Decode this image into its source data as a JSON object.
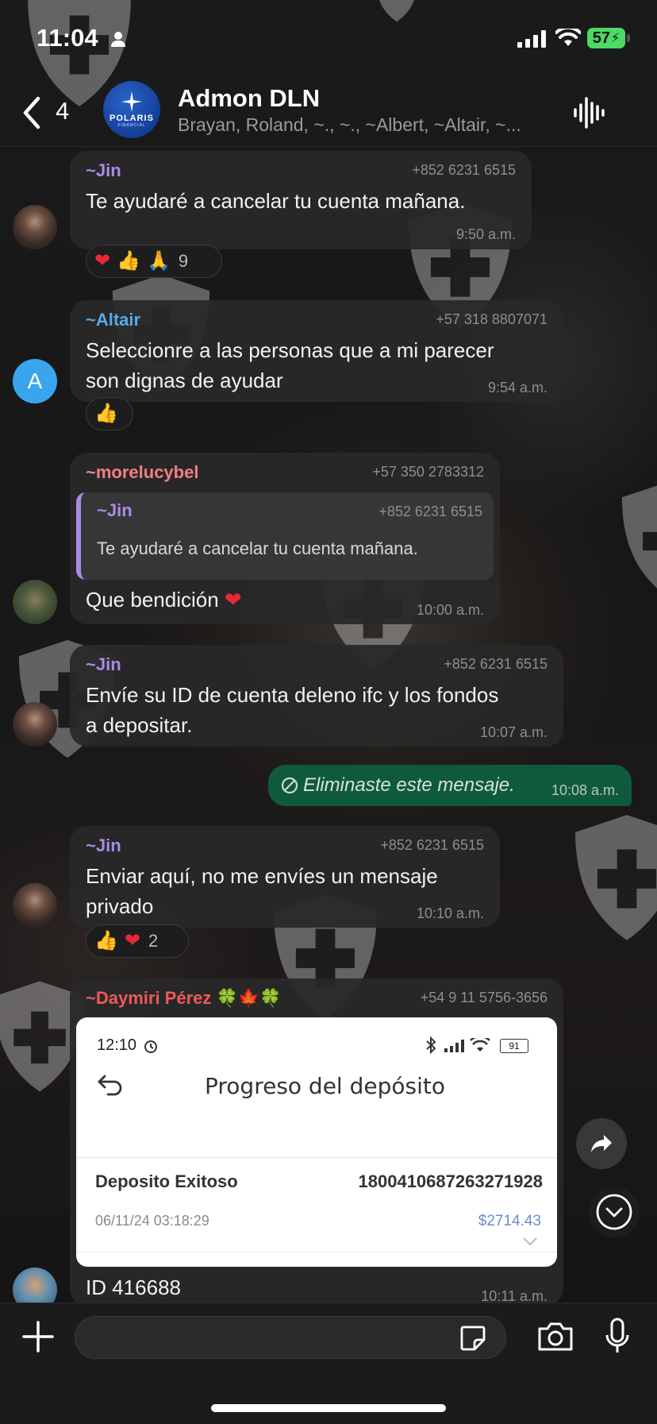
{
  "status_bar": {
    "time": "11:04",
    "battery": "57"
  },
  "header": {
    "back_count": "4",
    "avatar_brand": "POLARIS",
    "avatar_sub": "FINANCIAL",
    "title": "Admon DLN",
    "members": "Brayan, Roland, ~., ~., ~Albert, ~Altair, ~..."
  },
  "colors": {
    "jin": "#a98be6",
    "altair": "#5aa9e6",
    "morelucybel": "#f07f84",
    "daymiri": "#f0585a",
    "outgoing": "#0f5a3d"
  },
  "messages": [
    {
      "sender": "~Jin",
      "phone": "+852 6231 6515",
      "text": "Te ayudaré a cancelar tu cuenta mañana.",
      "time": "9:50 a.m.",
      "reactions": {
        "count": "9"
      }
    },
    {
      "sender": "~Altair",
      "phone": "+57 318 8807071",
      "text": "Seleccionre a las personas que a mi parecer son dignas de ayudar",
      "time": "9:54 a.m.",
      "avatar_letter": "A"
    },
    {
      "sender": "~morelucybel",
      "phone": "+57 350 2783312",
      "quote_sender": "~Jin",
      "quote_phone": "+852 6231 6515",
      "quote_text": "Te ayudaré a cancelar tu cuenta mañana.",
      "text": "Que bendición",
      "time": "10:00 a.m."
    },
    {
      "sender": "~Jin",
      "phone": "+852 6231 6515",
      "text": "Envíe su ID de cuenta deleno ifc y los fondos a depositar.",
      "time": "10:07 a.m."
    },
    {
      "outgoing_text": "Eliminaste este mensaje.",
      "time": "10:08 a.m."
    },
    {
      "sender": "~Jin",
      "phone": "+852 6231 6515",
      "text": "Enviar aquí, no me envíes un mensaje privado",
      "time": "10:10 a.m.",
      "reactions": {
        "count": "2"
      }
    },
    {
      "sender": "~Daymiri Pérez 🍀🍁🍀",
      "phone": "+54 9 11 5756-3656",
      "image": {
        "time": "12:10",
        "battery": "91",
        "title": "Progreso del depósito",
        "label": "Deposito Exitoso",
        "number": "1800410687263271928",
        "date": "06/11/24 03:18:29",
        "amount": "$2714.43"
      },
      "text": "ID 416688",
      "time": "10:11 a.m."
    }
  ],
  "input": {
    "placeholder": ""
  }
}
